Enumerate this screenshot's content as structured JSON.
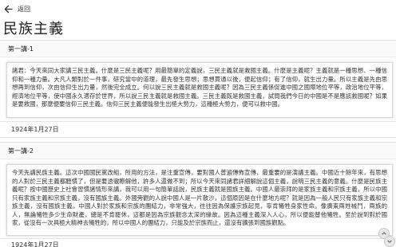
{
  "appbar": {
    "title": "返回"
  },
  "page": {
    "title": "民族主義"
  },
  "sections": [
    {
      "header": "第一講-1",
      "body": "諸君：今天來同大家講三民主義。什麼是三民主義呢？用最簡單的定義說，三民主義就是救國主義。什麼是主義呢？主義就是一種思想、一種信仰和一種力量。大凡人類對於一件事，研究當中的道理，最先發生思想；思想貫通以後，便起信仰；有了信仰，就生出力量。所以主義是先由思想再到信仰，次由信仰生出力量，然後完全成立。何以說三民主義就是救國主義呢？因為三民主義係促進中國之國際地位平等，政治地位平等，經濟地位平等，使中國永久適存於世界，所以說三民主義就是救國主義。三民主義既是救國主義，試問我們今日的中國是不是應該救國呢？如果是要救國，那麼便要信仰三民主義。信仰三民主義便能發生出極大勢力，這種極大勢力，便可以救中國。",
      "date": "1924年1月27日"
    },
    {
      "header": "第一講-2",
      "body": "今天先講民族主義。這次中國國民黨改組，所用的方法，是注重宣傳，要對國人普遍傳佈宣傳，最重要的是演講主義。中國近十餘年來，有思想的人對於三民主義都聽慣了，但是要透徹瞭解他，許多人還做不到；所以今天來同諸君詳細解說這個主義，說明三民主義的意義。什麼是民族主義呢？按中國歷史上社會習慣諸情形來講，我可以用一句簡單話說，民族主義就是國族主義。中國人最崇拜的是家族主義和宗族主義，所以中國只有家族主義和宗族主義，沒有國族主義。外國旁觀的人說中國人是一片散沙，這個原因是在什麼地方呢？就是因為一般人民只有家族主義和宗族主義，沒有國族主義。中國人對於家族和宗族的團結力，非常強大，往往因為保護宗族起見，寧肯犧牲身家性命。像廣東兩姓械鬥，兩族的人，無論犧牲多少生命財產，總是不肯罷休，這都是因為宗族觀念太深的緣故。因為這種主義深入人心，所以便能替他犧牲。至於說到對於國家，從沒有一次具極大精神去犧牲的，所以中國人的團結力，只能及於宗族而止，還沒有擴張到國族觀點。",
      "date": "1924年1月27日"
    }
  ]
}
